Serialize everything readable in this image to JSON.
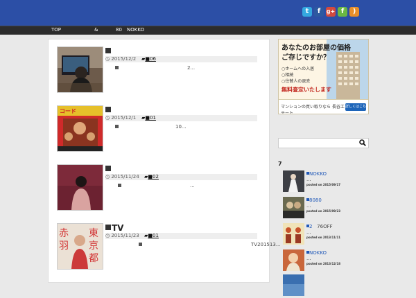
{
  "header": {
    "social": [
      {
        "name": "twitter",
        "glyph": "t",
        "color": "#34a8e0"
      },
      {
        "name": "facebook",
        "glyph": "f",
        "color": "#2d59a0"
      },
      {
        "name": "googleplus",
        "glyph": "g+",
        "color": "#d24a3e"
      },
      {
        "name": "feedly",
        "glyph": "f",
        "color": "#6ab843"
      },
      {
        "name": "rss",
        "glyph": ")",
        "color": "#e88f28"
      }
    ]
  },
  "nav": {
    "items": [
      "TOP",
      "&",
      "80",
      "NOKKO"
    ]
  },
  "posts": [
    {
      "title": "",
      "date": "2015/12/2",
      "category": "06",
      "excerpt": "2..."
    },
    {
      "title": "",
      "date": "2015/12/1",
      "category": "01",
      "excerpt": "10..."
    },
    {
      "title": "",
      "date": "2015/11/24",
      "category": "02",
      "excerpt": "..."
    },
    {
      "title": "TV",
      "date": "2015/11/23",
      "category": "01",
      "excerpt": "TV201513..."
    }
  ],
  "ad": {
    "line1": "あなたのお部屋の価格",
    "line2": "ご存じですか？",
    "list": [
      "ホームへの入居",
      "相続",
      "住替人の退去"
    ],
    "free": "無料査定いたします",
    "company": "マンションの買い取りなら 長谷工 リアルエステート",
    "button": "詳しくはこちら"
  },
  "sidebar": {
    "widget_title": "7",
    "ranking": [
      {
        "title": "NOKKO",
        "excerpt": "...",
        "posted": "posted on 2015/09/17"
      },
      {
        "title": "8080",
        "excerpt": "...",
        "posted": "posted on 2015/09/23"
      },
      {
        "title": "2",
        "title_suffix": "76OFF",
        "excerpt": "...",
        "posted": "posted on 2013/11/11"
      },
      {
        "title": "NOKKO",
        "excerpt": "...",
        "posted": "posted on 2013/12/18"
      }
    ]
  }
}
